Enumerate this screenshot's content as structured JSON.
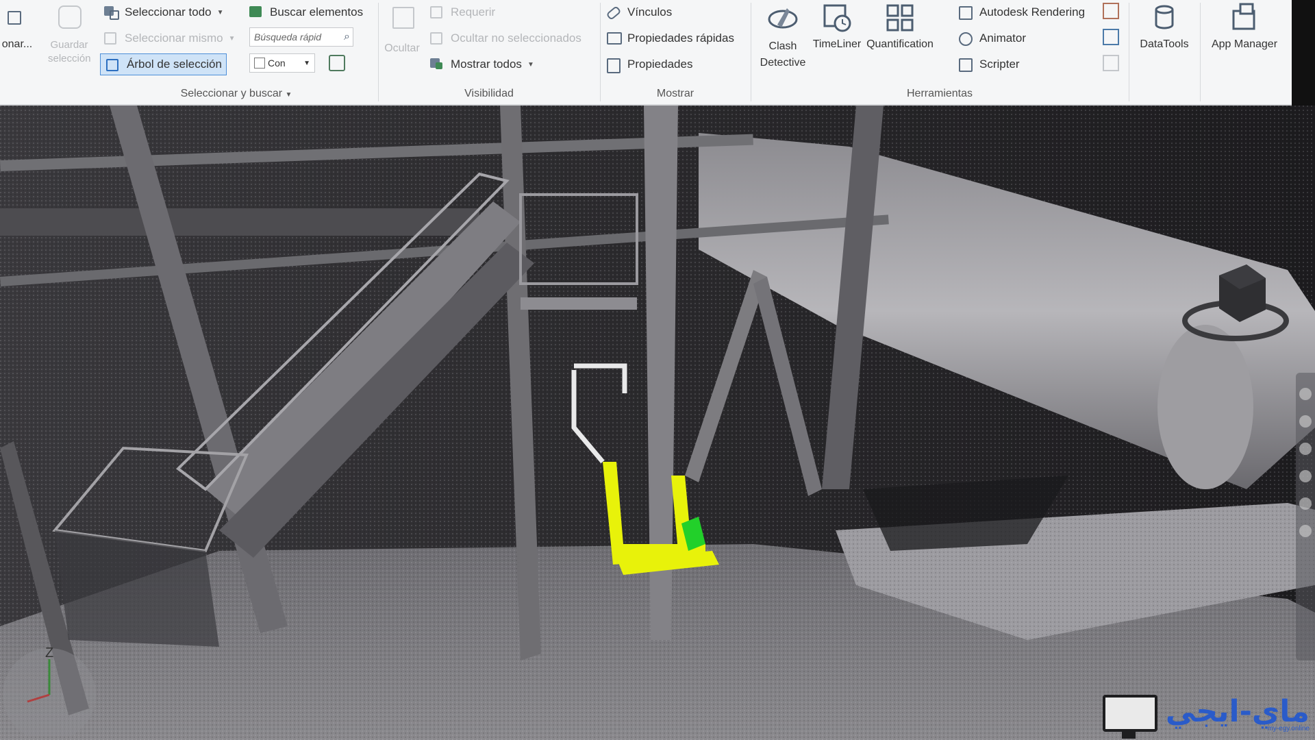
{
  "ribbon": {
    "left_cut_label": "onar...",
    "guardar": {
      "label": "Guardar selección"
    },
    "select_search": {
      "select_all": "Seleccionar todo",
      "select_same": "Seleccionar mismo",
      "selection_tree": "Árbol de selección",
      "find_items": "Buscar elementos",
      "quick_find_placeholder": "Búsqueda rápid",
      "combo_value": "Con",
      "panel_label": "Seleccionar y buscar"
    },
    "visibility": {
      "hide": "Ocultar",
      "require": "Requerir",
      "hide_unselected": "Ocultar no seleccionados",
      "unhide_all": "Mostrar todos",
      "panel_label": "Visibilidad"
    },
    "display": {
      "links": "Vínculos",
      "quick_properties": "Propiedades rápidas",
      "properties": "Propiedades",
      "panel_label": "Mostrar"
    },
    "tools": {
      "clash_detective": "Clash Detective",
      "timeliner": "TimeLiner",
      "quantification": "Quantification",
      "autodesk_rendering": "Autodesk Rendering",
      "animator": "Animator",
      "scripter": "Scripter",
      "datatools": "DataTools",
      "app_manager": "App Manager",
      "panel_label": "Herramientas"
    }
  },
  "viewport": {
    "compass_letter": "Z",
    "watermark_text": "ماي-ايجي",
    "watermark_sub": "my-egy.online"
  },
  "colors": {
    "highlight_yellow": "#e8f20a",
    "highlight_green": "#22d02a",
    "selection_blue": "#4c8ed8",
    "watermark_blue": "#2a5bc9"
  }
}
